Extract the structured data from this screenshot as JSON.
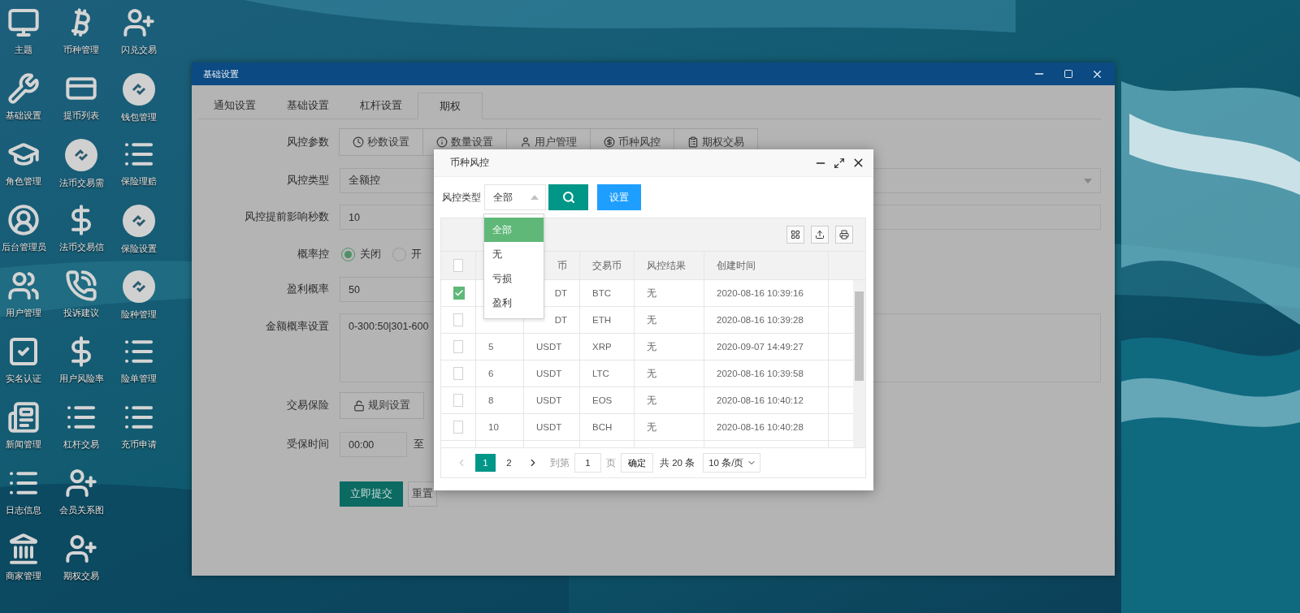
{
  "desktop_icons": [
    {
      "label": "主题",
      "kind": "monitor"
    },
    {
      "label": "基础设置",
      "kind": "wrench"
    },
    {
      "label": "角色管理",
      "kind": "cap"
    },
    {
      "label": "后台管理员",
      "kind": "user"
    },
    {
      "label": "用户管理",
      "kind": "users"
    },
    {
      "label": "实名认证",
      "kind": "check"
    },
    {
      "label": "新闻管理",
      "kind": "news"
    },
    {
      "label": "日志信息",
      "kind": "list"
    },
    {
      "label": "商家管理",
      "kind": "bank"
    },
    {
      "label": "币种管理",
      "kind": "bitcoin"
    },
    {
      "label": "提币列表",
      "kind": "card"
    },
    {
      "label": "法币交易需",
      "kind": "link"
    },
    {
      "label": "法币交易信",
      "kind": "dollar"
    },
    {
      "label": "投诉建议",
      "kind": "phone"
    },
    {
      "label": "用户风险率",
      "kind": "dollar"
    },
    {
      "label": "杠杆交易",
      "kind": "list"
    },
    {
      "label": "会员关系图",
      "kind": "userplus"
    },
    {
      "label": "期权交易",
      "kind": "userplus"
    },
    {
      "label": "闪兑交易",
      "kind": "userplus"
    },
    {
      "label": "钱包管理",
      "kind": "link"
    },
    {
      "label": "保险理赔",
      "kind": "list"
    },
    {
      "label": "保险设置",
      "kind": "link"
    },
    {
      "label": "险种管理",
      "kind": "link"
    },
    {
      "label": "险单管理",
      "kind": "list"
    },
    {
      "label": "充币申请",
      "kind": "list"
    }
  ],
  "window": {
    "title": "基础设置",
    "tabs": [
      {
        "label": "通知设置",
        "selected": false
      },
      {
        "label": "基础设置",
        "selected": false
      },
      {
        "label": "杠杆设置",
        "selected": false
      },
      {
        "label": "期权",
        "selected": true
      }
    ],
    "form": [
      {
        "kind": "segmented",
        "label": "风控参数",
        "buttons": [
          {
            "label": "秒数设置",
            "kind": "clock"
          },
          {
            "label": "数量设置",
            "kind": "info"
          },
          {
            "label": "用户管理",
            "kind": "user"
          },
          {
            "label": "币种风控",
            "kind": "dollar"
          },
          {
            "label": "期权交易",
            "kind": "clipboard"
          }
        ]
      },
      {
        "kind": "select",
        "label": "风控类型",
        "value": "全额控"
      },
      {
        "kind": "input",
        "label": "风控提前影响秒数",
        "value": "10"
      },
      {
        "kind": "radio",
        "label": "概率控",
        "options": [
          {
            "label": "关闭",
            "selected": true
          },
          {
            "label": "开",
            "selected": false
          }
        ]
      },
      {
        "kind": "short_input",
        "label": "盈利概率",
        "value": "50"
      },
      {
        "kind": "textarea",
        "label": "金额概率设置",
        "value": "0-300:50|301-600"
      },
      {
        "kind": "button",
        "label": "交易保险",
        "button": "规则设置"
      },
      {
        "kind": "time_range",
        "label": "受保时间",
        "value": "00:00",
        "separator": "至"
      }
    ],
    "actions": [
      {
        "label": "立即提交",
        "kind": "primary"
      },
      {
        "label": "重置",
        "kind": "secondary"
      }
    ]
  },
  "modal": {
    "title": "币种风控",
    "filter": {
      "label": "风控类型",
      "value": "全部",
      "options": [
        {
          "label": "全部",
          "selected": true
        },
        {
          "label": "无",
          "selected": false
        },
        {
          "label": "亏损",
          "selected": false
        },
        {
          "label": "盈利",
          "selected": false
        }
      ]
    },
    "buttons": [
      {
        "kind": "search"
      },
      {
        "kind": "primary",
        "label": "设置"
      }
    ],
    "table": {
      "header_checked": false,
      "columns": [
        null,
        "币",
        "交易币",
        "风控结果",
        "创建时间"
      ],
      "rows": [
        {
          "checked": true,
          "cells": [
            null,
            "DT",
            "BTC",
            "无",
            "2020-08-16 10:39:16"
          ]
        },
        {
          "checked": false,
          "cells": [
            null,
            "DT",
            "ETH",
            "无",
            "2020-08-16 10:39:28"
          ]
        },
        {
          "checked": false,
          "cells": [
            "5",
            "USDT",
            "XRP",
            "无",
            "2020-09-07 14:49:27"
          ]
        },
        {
          "checked": false,
          "cells": [
            "6",
            "USDT",
            "LTC",
            "无",
            "2020-08-16 10:39:58"
          ]
        },
        {
          "checked": false,
          "cells": [
            "8",
            "USDT",
            "EOS",
            "无",
            "2020-08-16 10:40:12"
          ]
        },
        {
          "checked": false,
          "cells": [
            "10",
            "USDT",
            "BCH",
            "无",
            "2020-08-16 10:40:28"
          ]
        }
      ]
    },
    "pagination": {
      "pages": [
        {
          "label": "1",
          "selected": true
        },
        {
          "label": "2",
          "selected": false
        }
      ],
      "goto_label": "到第",
      "goto_value": "1",
      "page_unit": "页",
      "confirm": "确定",
      "total": "共 20 条",
      "page_size": "10 条/页"
    }
  }
}
